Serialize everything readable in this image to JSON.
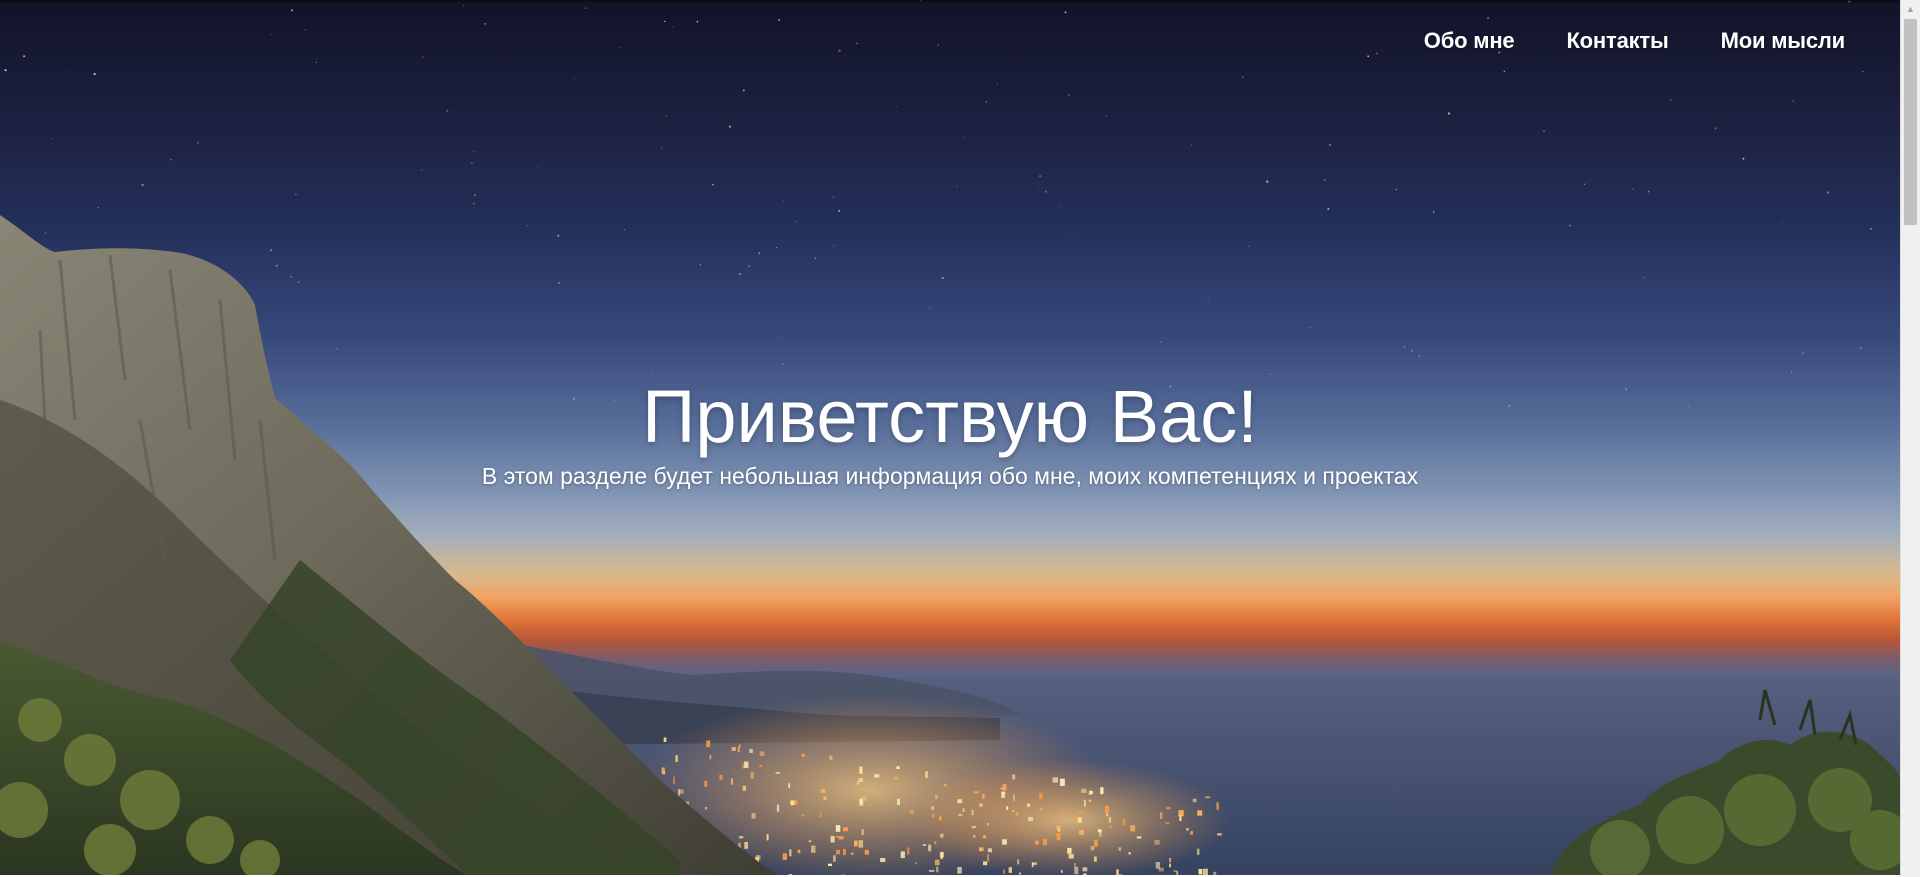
{
  "nav": {
    "items": [
      {
        "label": "Обо мне"
      },
      {
        "label": "Контакты"
      },
      {
        "label": "Мои мысли"
      }
    ]
  },
  "hero": {
    "title": "Приветствую Вас!",
    "subtitle": "В этом разделе будет небольшая информация обо мне, моих компетенциях и проектах",
    "background_image": "night-landscape-cliff-coastal-city-sunset"
  },
  "scrollbar": {
    "up_icon": "chevron-up-icon"
  },
  "colors": {
    "text": "#ffffff",
    "sky_top": "#121329",
    "sky_mid": "#36477a",
    "horizon_orange": "#f0a565",
    "sea": "#4c5b7e"
  }
}
